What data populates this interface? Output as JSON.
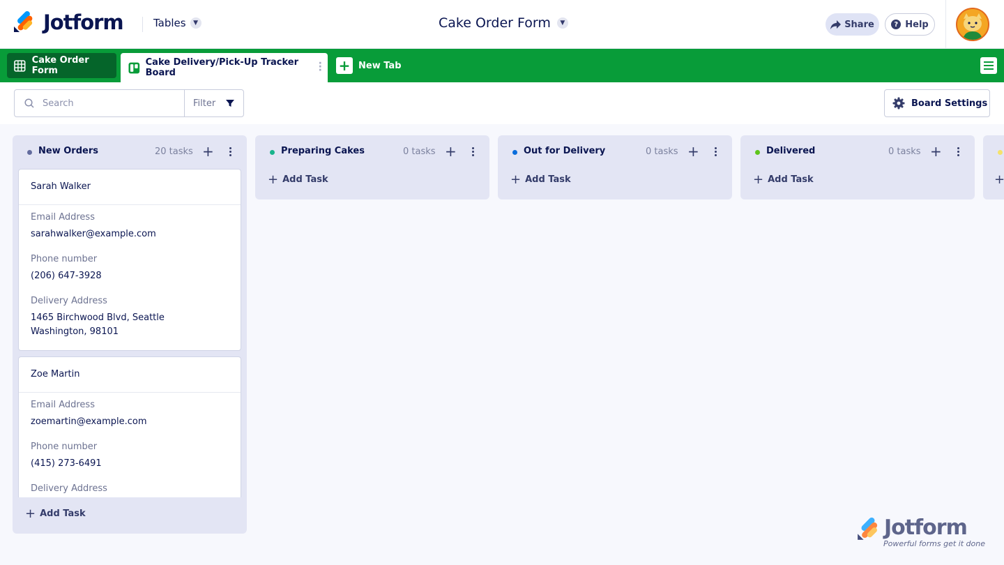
{
  "brand": {
    "name": "Jotform",
    "watermark_name": "Jotform",
    "watermark_tagline": "Powerful forms get it done"
  },
  "header": {
    "tables_label": "Tables",
    "form_title": "Cake Order Form",
    "share_label": "Share",
    "help_label": "Help",
    "help_glyph": "?"
  },
  "tabs": [
    {
      "label": "Cake Order Form",
      "icon": "table-grid-icon",
      "active": false
    },
    {
      "label": "Cake Delivery/Pick-Up Tracker Board",
      "icon": "board-icon",
      "active": true
    }
  ],
  "new_tab_label": "New Tab",
  "toolbar": {
    "search_placeholder": "Search",
    "filter_label": "Filter",
    "board_settings_label": "Board Settings"
  },
  "board": {
    "add_task_label": "Add Task",
    "columns": [
      {
        "title": "New Orders",
        "count": "20 tasks",
        "dot_color": "#636c9e"
      },
      {
        "title": "Preparing Cakes",
        "count": "0 tasks",
        "dot_color": "#18b48c"
      },
      {
        "title": "Out for Delivery",
        "count": "0 tasks",
        "dot_color": "#0a6ddc"
      },
      {
        "title": "Delivered",
        "count": "0 tasks",
        "dot_color": "#5ec41b"
      }
    ],
    "cards": [
      {
        "name": "Sarah Walker",
        "email_label": "Email Address",
        "email": "sarahwalker@example.com",
        "phone_label": "Phone number",
        "phone": "(206) 647-3928",
        "address_label": "Delivery Address",
        "address_line1": "1465 Birchwood Blvd, Seattle",
        "address_line2": "Washington, 98101"
      },
      {
        "name": "Zoe Martin",
        "email_label": "Email Address",
        "email": "zoemartin@example.com",
        "phone_label": "Phone number",
        "phone": "(415) 273-6491",
        "address_label": "Delivery Address"
      }
    ]
  }
}
